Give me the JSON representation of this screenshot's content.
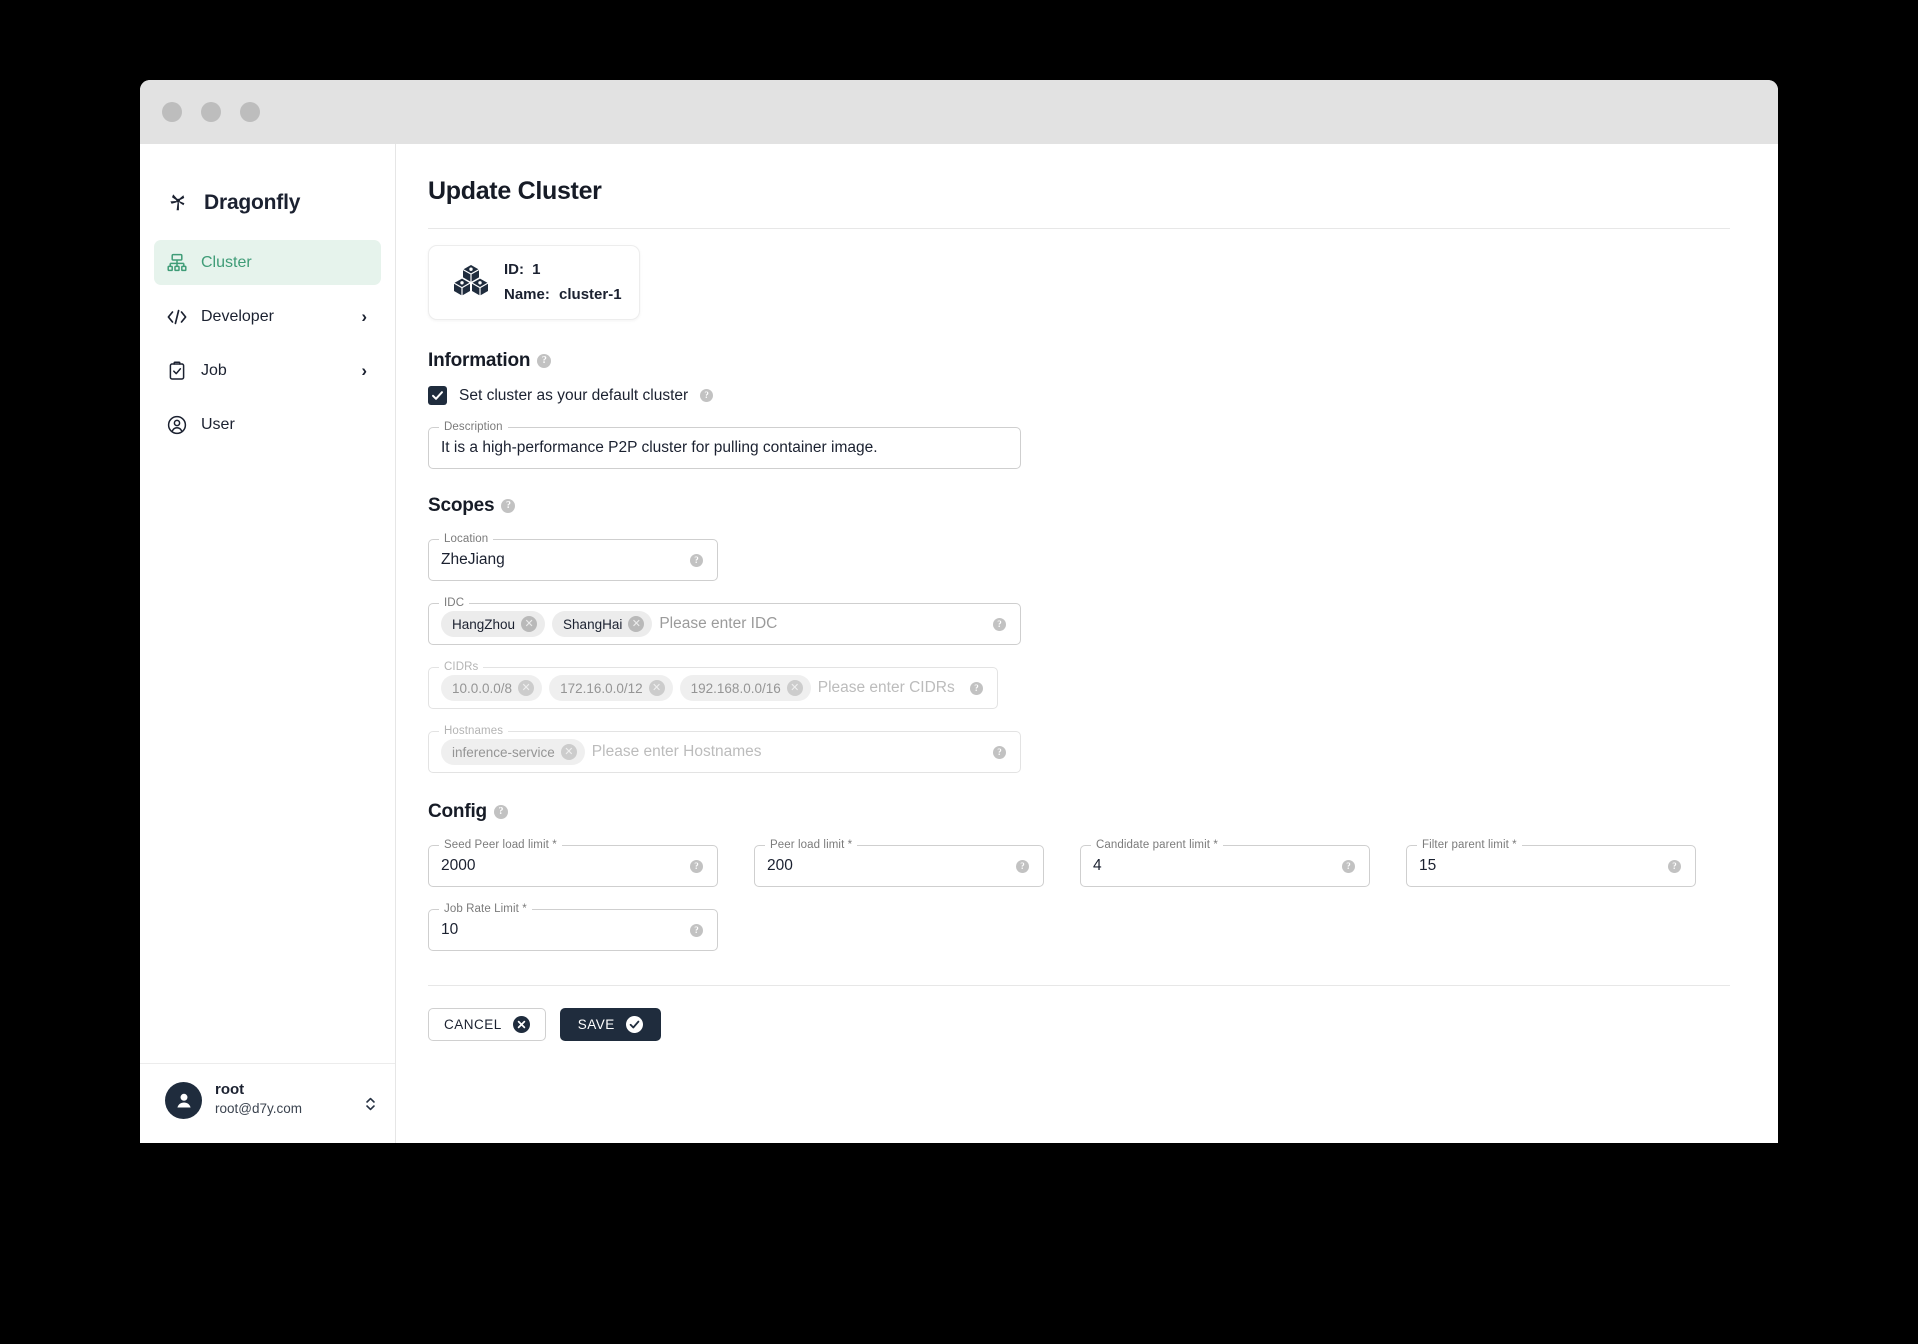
{
  "window": {
    "traffic_lights": [
      "close-dot",
      "minimize-dot",
      "maximize-dot"
    ]
  },
  "sidebar": {
    "brand": "Dragonfly",
    "brand_icon": "dragonfly-logo-icon",
    "items": [
      {
        "label": "Cluster",
        "icon": "cluster-icon",
        "active": true,
        "expandable": false
      },
      {
        "label": "Developer",
        "icon": "code-icon",
        "active": false,
        "expandable": true
      },
      {
        "label": "Job",
        "icon": "clipboard-check-icon",
        "active": false,
        "expandable": true
      },
      {
        "label": "User",
        "icon": "user-circle-icon",
        "active": false,
        "expandable": false
      }
    ],
    "chevron": "›",
    "user": {
      "name": "root",
      "email": "root@d7y.com",
      "avatar_icon": "avatar-icon",
      "expand_icon": "up-down-chevron-icon"
    }
  },
  "main": {
    "page_title": "Update Cluster",
    "id_card": {
      "icon": "cubes-icon",
      "id_label": "ID:",
      "id_value": "1",
      "name_label": "Name:",
      "name_value": "cluster-1"
    },
    "information": {
      "heading": "Information",
      "help": "?",
      "default_cluster_checkbox": {
        "label": "Set cluster as your default cluster",
        "checked": true,
        "help": "?"
      },
      "description": {
        "legend": "Description",
        "value": "It is a high-performance P2P cluster for pulling container image."
      }
    },
    "scopes": {
      "heading": "Scopes",
      "help": "?",
      "location": {
        "legend": "Location",
        "value": "ZheJiang",
        "help": "?"
      },
      "idc": {
        "legend": "IDC",
        "chips": [
          "HangZhou",
          "ShangHai"
        ],
        "placeholder": "Please enter IDC",
        "help": "?",
        "disabled": false
      },
      "cidrs": {
        "legend": "CIDRs",
        "chips": [
          "10.0.0.0/8",
          "172.16.0.0/12",
          "192.168.0.0/16"
        ],
        "placeholder": "Please enter CIDRs",
        "help": "?",
        "disabled": true
      },
      "hostnames": {
        "legend": "Hostnames",
        "chips": [
          "inference-service"
        ],
        "placeholder": "Please enter Hostnames",
        "help": "?",
        "disabled": true
      }
    },
    "config": {
      "heading": "Config",
      "help": "?",
      "fields": [
        {
          "legend": "Seed Peer load limit *",
          "value": "2000",
          "help": "?"
        },
        {
          "legend": "Peer load limit *",
          "value": "200",
          "help": "?"
        },
        {
          "legend": "Candidate parent limit *",
          "value": "4",
          "help": "?"
        },
        {
          "legend": "Filter parent limit *",
          "value": "15",
          "help": "?"
        },
        {
          "legend": "Job Rate Limit *",
          "value": "10",
          "help": "?"
        }
      ]
    },
    "actions": {
      "cancel_label": "CANCEL",
      "cancel_icon": "close-circle-icon",
      "save_label": "SAVE",
      "save_icon": "check-circle-icon"
    }
  },
  "colors": {
    "accent_green": "#3f9c77",
    "accent_green_bg": "#e6f3ec",
    "dark": "#1f2c3d",
    "page_bg": "#ffffff",
    "titlebar": "#e2e2e2"
  }
}
